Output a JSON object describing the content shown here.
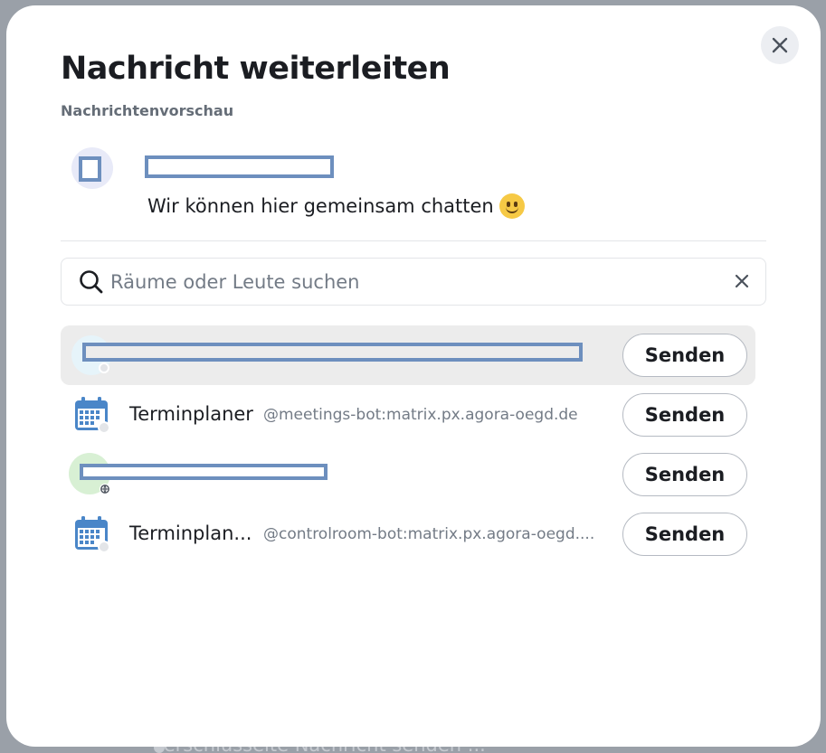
{
  "backdrop": {
    "composer_placeholder": "Verschlüsselte Nachricht senden ..."
  },
  "dialog": {
    "title": "Nachricht weiterleiten",
    "preview_label": "Nachrichtenvorschau",
    "preview_message": "Wir können hier gemeinsam chatten",
    "preview_emoji": "slightly-smiling-face-icon",
    "close_icon": "close-icon"
  },
  "search": {
    "placeholder": "Räume oder Leute suchen",
    "value": "",
    "icon": "search-icon",
    "clear_icon": "clear-icon"
  },
  "rooms": [
    {
      "name": "",
      "id": "",
      "avatar": "room-avatar",
      "send_label": "Senden",
      "highlighted": true
    },
    {
      "name": "Terminplaner",
      "id": "@meetings-bot:matrix.px.agora-oegd.de",
      "avatar": "calendar-icon",
      "send_label": "Senden",
      "highlighted": false
    },
    {
      "name": "",
      "id": "",
      "avatar": "room-avatar",
      "send_label": "Senden",
      "highlighted": false
    },
    {
      "name": "Terminplan...",
      "id": "@controlroom-bot:matrix.px.agora-oegd....",
      "avatar": "calendar-icon",
      "send_label": "Senden",
      "highlighted": false
    }
  ],
  "colors": {
    "accent_redaction": "#6d8fbe",
    "calendar_blue": "#4a86c8",
    "avatar_green": "#d8f0d4",
    "avatar_blue": "#e6f4fa",
    "preview_avatar": "#e8eaf8"
  }
}
